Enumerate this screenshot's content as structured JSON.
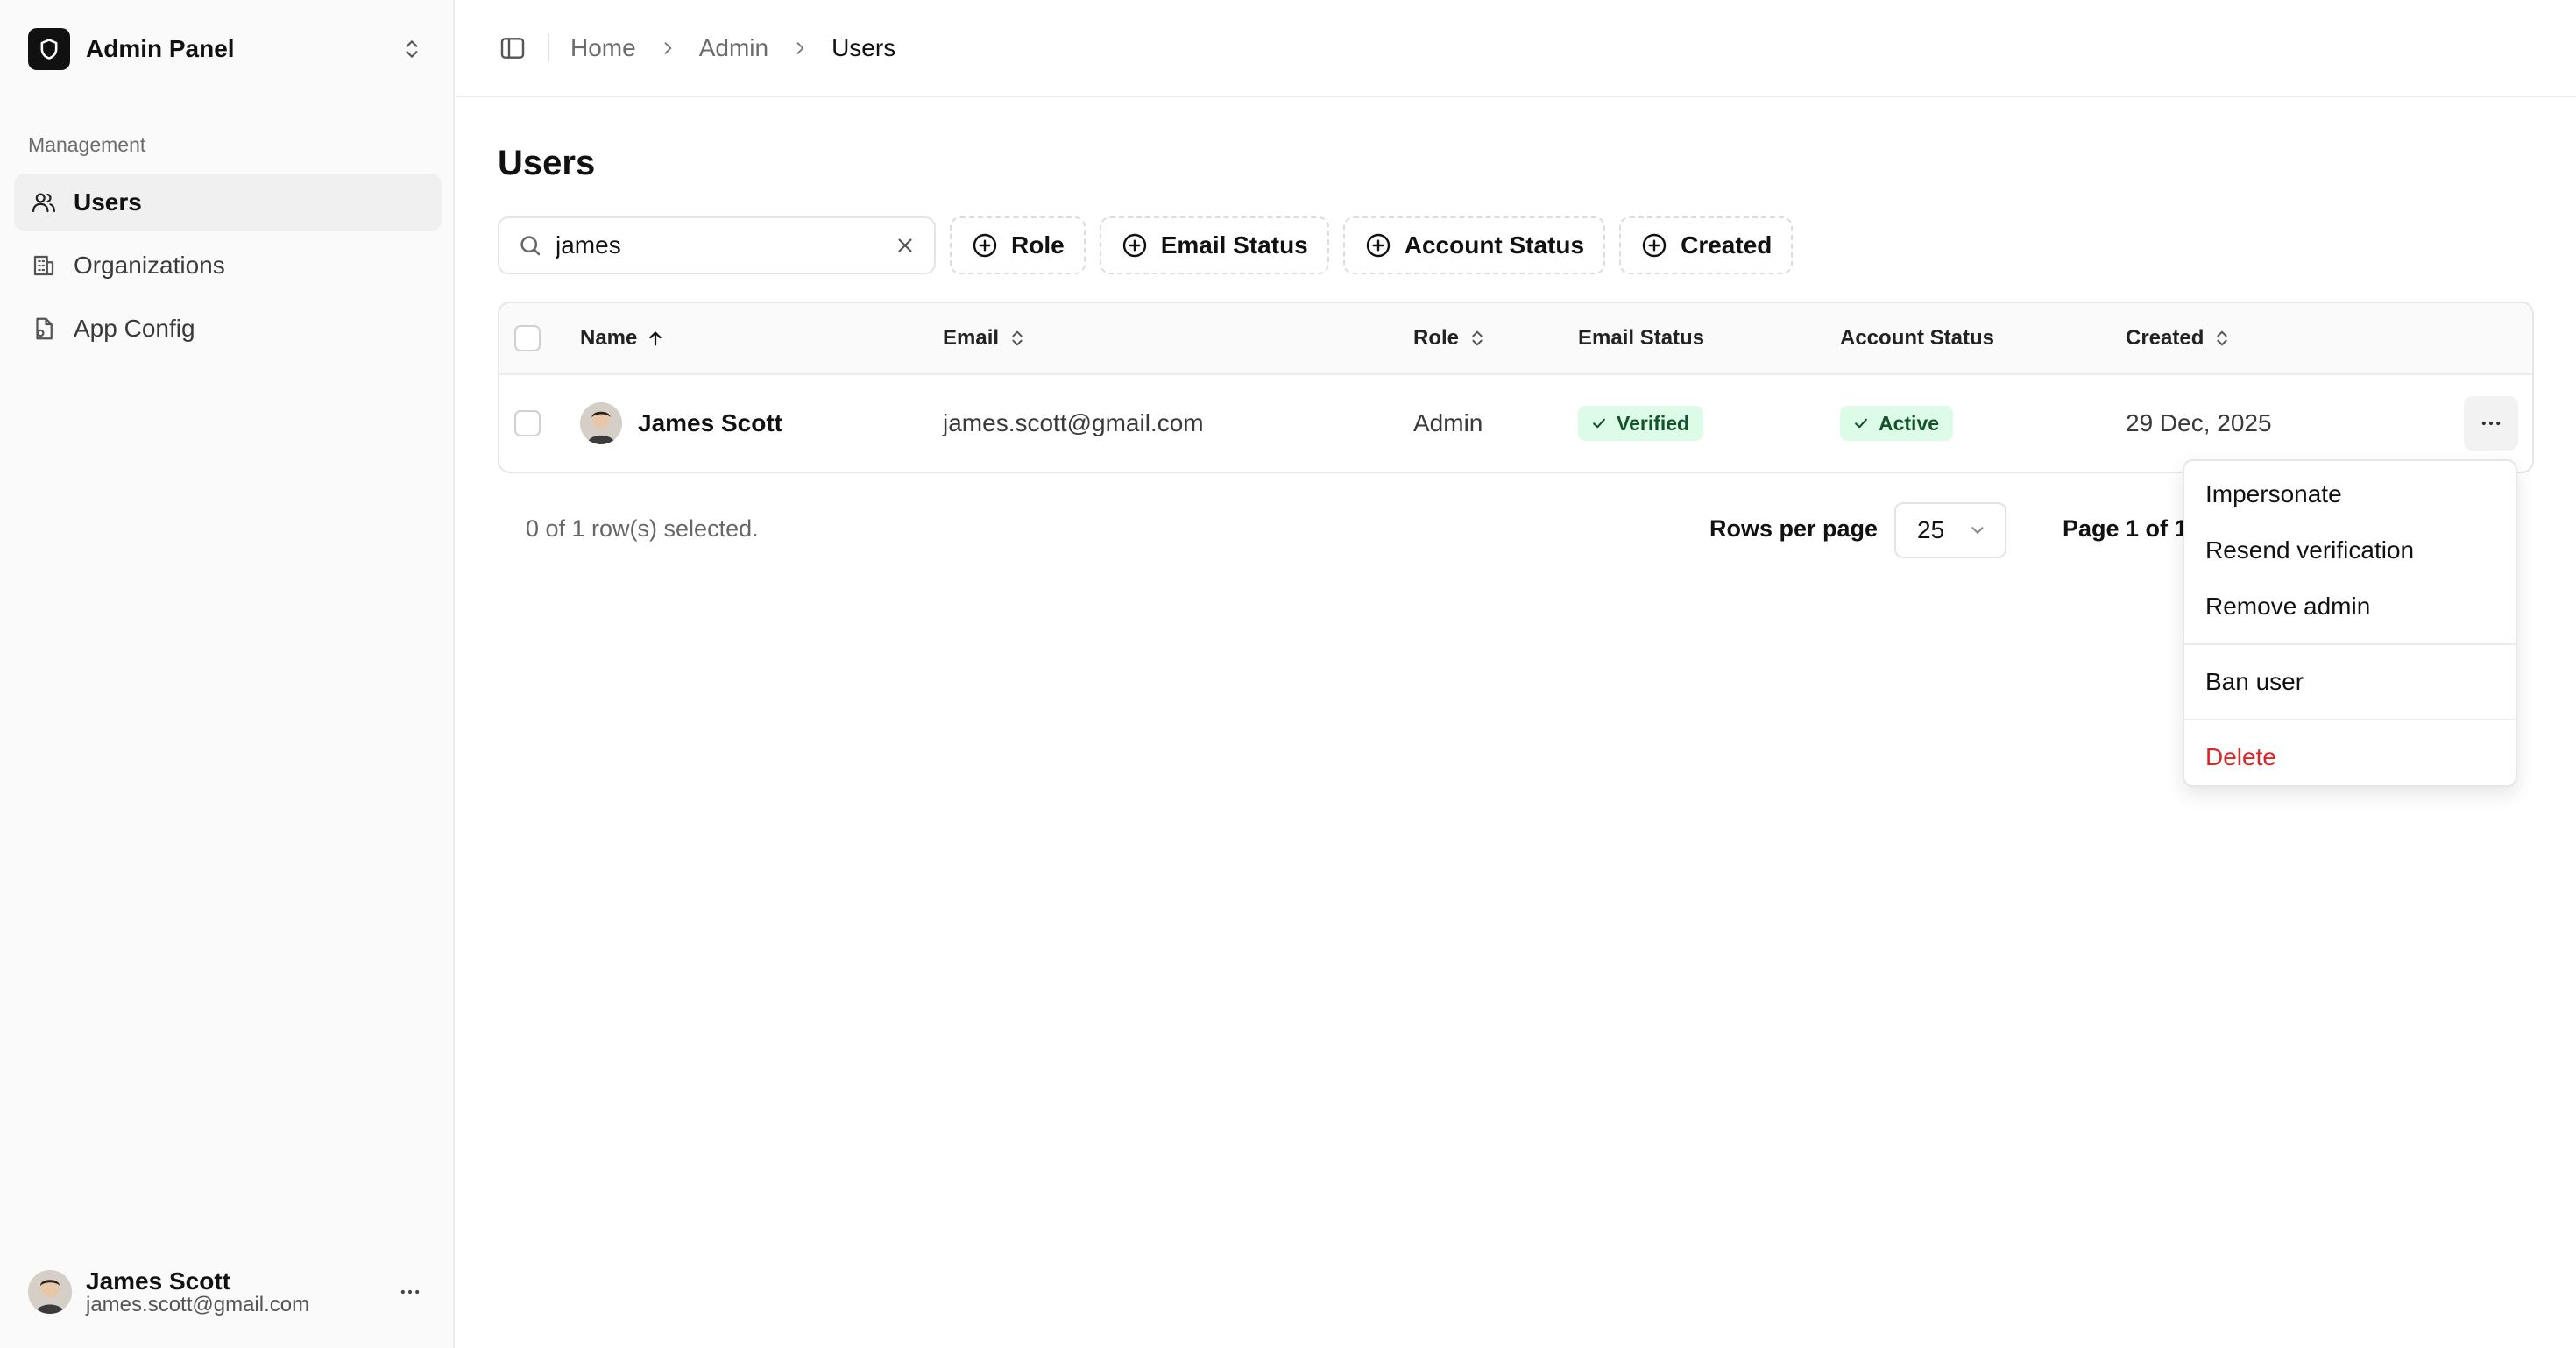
{
  "brand": {
    "title": "Admin Panel"
  },
  "sidebar": {
    "section_label": "Management",
    "items": [
      {
        "label": "Users",
        "icon": "users-icon",
        "active": true
      },
      {
        "label": "Organizations",
        "icon": "building-icon",
        "active": false
      },
      {
        "label": "App Config",
        "icon": "file-config-icon",
        "active": false
      }
    ],
    "user": {
      "name": "James Scott",
      "email": "james.scott@gmail.com"
    }
  },
  "breadcrumb": [
    "Home",
    "Admin",
    "Users"
  ],
  "page": {
    "title": "Users"
  },
  "search": {
    "value": "james"
  },
  "filters": [
    "Role",
    "Email Status",
    "Account Status",
    "Created"
  ],
  "table": {
    "columns": [
      "Name",
      "Email",
      "Role",
      "Email Status",
      "Account Status",
      "Created"
    ],
    "rows": [
      {
        "name": "James Scott",
        "email": "james.scott@gmail.com",
        "role": "Admin",
        "email_status": "Verified",
        "account_status": "Active",
        "created": "29 Dec, 2025"
      }
    ]
  },
  "pagination": {
    "selected_text": "0 of 1 row(s) selected.",
    "rows_per_page_label": "Rows per page",
    "rows_per_page_value": "25",
    "page_text": "Page 1 of 1"
  },
  "row_menu": {
    "items": [
      "Impersonate",
      "Resend verification",
      "Remove admin"
    ],
    "ban": "Ban user",
    "delete": "Delete"
  },
  "colors": {
    "badge_bg": "#dcfce7",
    "badge_text": "#14532d",
    "danger": "#dc2626",
    "sidebar_bg": "#fafafa"
  }
}
